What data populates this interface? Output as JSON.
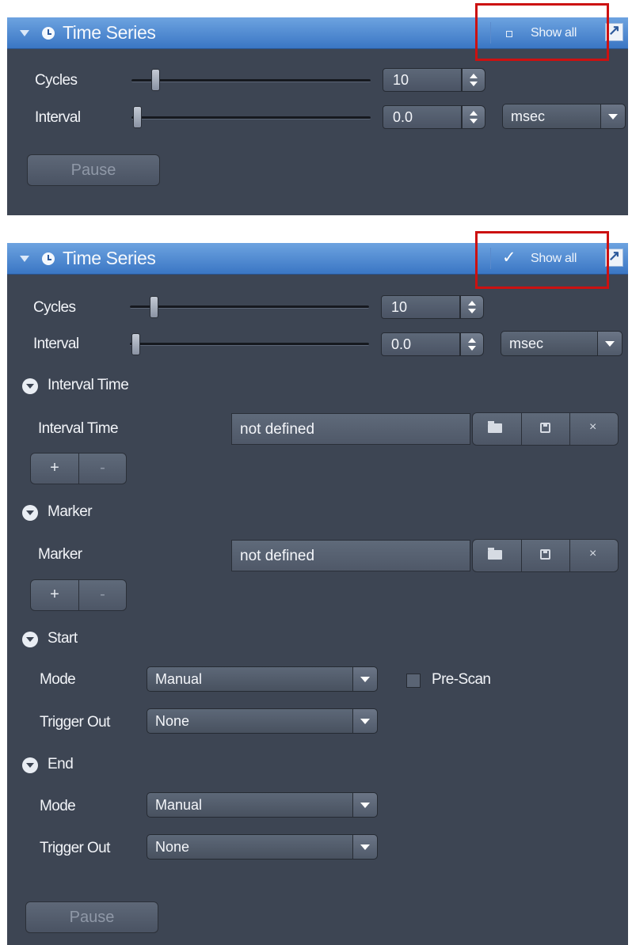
{
  "colors": {
    "highlight_box": "#cc1111",
    "header_blue": "#4a85d0",
    "panel_bg": "#3d4553"
  },
  "panel1": {
    "title": "Time Series",
    "icons": {
      "collapse": "caret-down-icon",
      "title": "clock-icon",
      "show_all": "unchecked-box-icon",
      "external": "external-link-icon"
    },
    "show_all_label": "Show all",
    "show_all_checked": false,
    "cycles": {
      "label": "Cycles",
      "value": "10",
      "slider_level": 0.09
    },
    "interval": {
      "label": "Interval",
      "value": "0.0",
      "unit": "msec",
      "slider_level": 0.0
    },
    "pause_label": "Pause"
  },
  "panel2": {
    "title": "Time Series",
    "icons": {
      "collapse": "caret-down-icon",
      "title": "clock-icon",
      "show_all": "checkmark-icon",
      "external": "external-link-icon"
    },
    "show_all_label": "Show all",
    "show_all_checked": true,
    "cycles": {
      "label": "Cycles",
      "value": "10",
      "slider_level": 0.09
    },
    "interval": {
      "label": "Interval",
      "value": "0.0",
      "unit": "msec",
      "slider_level": 0.0
    },
    "interval_time": {
      "header": "Interval Time",
      "label": "Interval Time",
      "value": "not defined",
      "icons": [
        "folder-open-icon",
        "save-icon",
        "close-icon"
      ],
      "delete_label": "×",
      "plus": "+",
      "minus": "-"
    },
    "marker": {
      "header": "Marker",
      "label": "Marker",
      "value": "not defined",
      "icons": [
        "folder-open-icon",
        "save-icon",
        "close-icon"
      ],
      "delete_label": "×",
      "plus": "+",
      "minus": "-"
    },
    "start": {
      "header": "Start",
      "mode_label": "Mode",
      "mode_value": "Manual",
      "prescan_label": "Pre-Scan",
      "prescan_checked": false,
      "trigger_label": "Trigger Out",
      "trigger_value": "None"
    },
    "end": {
      "header": "End",
      "mode_label": "Mode",
      "mode_value": "Manual",
      "trigger_label": "Trigger Out",
      "trigger_value": "None"
    },
    "pause_label": "Pause"
  }
}
